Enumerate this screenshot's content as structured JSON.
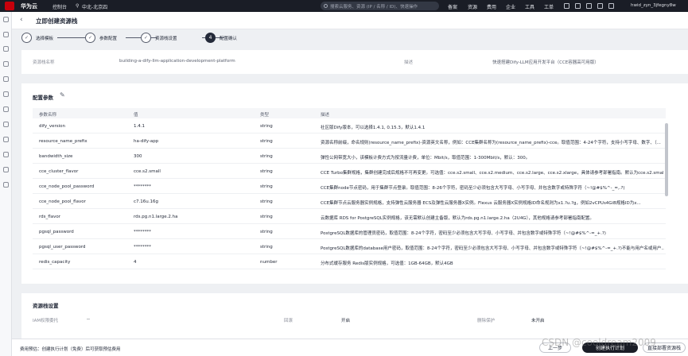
{
  "topbar": {
    "brand": "华为云",
    "console": "控制台",
    "region": "中北-北京四",
    "search_placeholder": "搜索云服务、资源 (IP / 名称 / ID)、快速操作",
    "links": [
      "备案",
      "资源",
      "费用",
      "企业",
      "工具",
      "工单"
    ],
    "user": "hwid_zyn_3jfegny8w"
  },
  "header": {
    "title": "立即创建资源栈"
  },
  "steps": [
    {
      "label": "选择模板",
      "state": "done"
    },
    {
      "label": "参数配置",
      "state": "done"
    },
    {
      "label": "资源栈设置",
      "state": "done"
    },
    {
      "label": "配置确认",
      "state": "active",
      "number": "4"
    }
  ],
  "info": {
    "name_label": "资源栈名称",
    "name_value": "building-a-dify-llm-application-development-platform",
    "desc_label": "描述",
    "desc_value": "快速搭建Dify-LLM应用开发平台（CCE容器高可用版）"
  },
  "params": {
    "title": "配置参数",
    "columns": [
      "参数名称",
      "值",
      "类型",
      "描述"
    ],
    "rows": [
      {
        "name": "dify_version",
        "value": "1.4.1",
        "type": "string",
        "desc": "社区版Dify版本，可以选择1.4.1, 0.15.3，默认1.4.1"
      },
      {
        "name": "resource_name_prefix",
        "value": "ha-dify-app",
        "type": "string",
        "desc": "资源名称前缀，命名规则(resource_name_prefix)-资源英文名称，例如：CCE集群名称为(resource_name_prefix)-cce。取值范围：4-24个字符，支持小写字母、数字、（..."
      },
      {
        "name": "bandwidth_size",
        "value": "300",
        "type": "string",
        "desc": "弹性公网带宽大小，该模板计费方式为按流量计费，单位：Mbit/s，取值范围：1-300Mbit/s，默认：300。"
      },
      {
        "name": "cce_cluster_flavor",
        "value": "cce.s2.small",
        "type": "string",
        "desc": "CCE Turbo集群规格，集群创建完成后规格不可再变更。可选值：cce.s2.small、cce.s2.medium、cce.s2.large、cce.s2.xlarge，具体请参考部署指南。默认为cce.s2.small(..."
      },
      {
        "name": "cce_node_pool_password",
        "value": "********",
        "type": "string",
        "desc": "CCE集群node节点密码，用于集群节点登录。取值范围：8-26个字符，密码至少必须包含大写字母、小写字母、并包含数字或特殊字符（~!@#$%^-_=,.?)"
      },
      {
        "name": "cce_node_pool_flavor",
        "value": "c7.16u.16g",
        "type": "string",
        "desc": "CCE集群节点云服务器实例规格，支持弹性云服务器 ECS及弹性云服务器X实例。Flexus 云服务器X实例规格ID命名规则为x1.?u.?g，例如2vCPUs4GiB规格ID为x..."
      },
      {
        "name": "rds_flavor",
        "value": "rds.pg.n1.large.2.ha",
        "type": "string",
        "desc": "云数据库 RDS for PostgreSQL实例规格，该无需默认创建主备版，默认为rds.pg.n1.large.2.ha（2U4G），其他规格请参考部署指南配置。"
      },
      {
        "name": "pgsql_password",
        "value": "********",
        "type": "string",
        "desc": "PostgreSQL数据库的管理员密码，取值范围：8-24个字符，密码至少必须包含大写字母、小写字母、并包含数字或特殊字符（~!@#$%^-=_+.?)"
      },
      {
        "name": "pgsql_user_password",
        "value": "********",
        "type": "string",
        "desc": "PostgreSQL数据库的database用户密码，取值范围：8-24个字符，密码至少必须包含大写字母、小写字母、并包含数字或特殊字符（~!@#$%^-=_+.?)不能与用户名或用户..."
      },
      {
        "name": "redis_capacity",
        "value": "4",
        "type": "number",
        "desc": "分布式缓存服务 Redis版实例规格，可选值：1GB-64GB，默认4GB"
      }
    ]
  },
  "stack_settings": {
    "title": "资源栈设置",
    "iam_label": "IAM权限委托",
    "iam_value": "--",
    "rollback_label": "回滚",
    "rollback_value": "开启",
    "protect_label": "删除保护",
    "protect_value": "未开启"
  },
  "footer": {
    "fee_text": "费用预估：创建执行计划（免费）后可获取预估费用",
    "prev_label": "上一步",
    "plan_label": "创建执行计划",
    "deploy_label": "直接部署资源栈"
  },
  "watermark": "CSDN @cooldream2009"
}
